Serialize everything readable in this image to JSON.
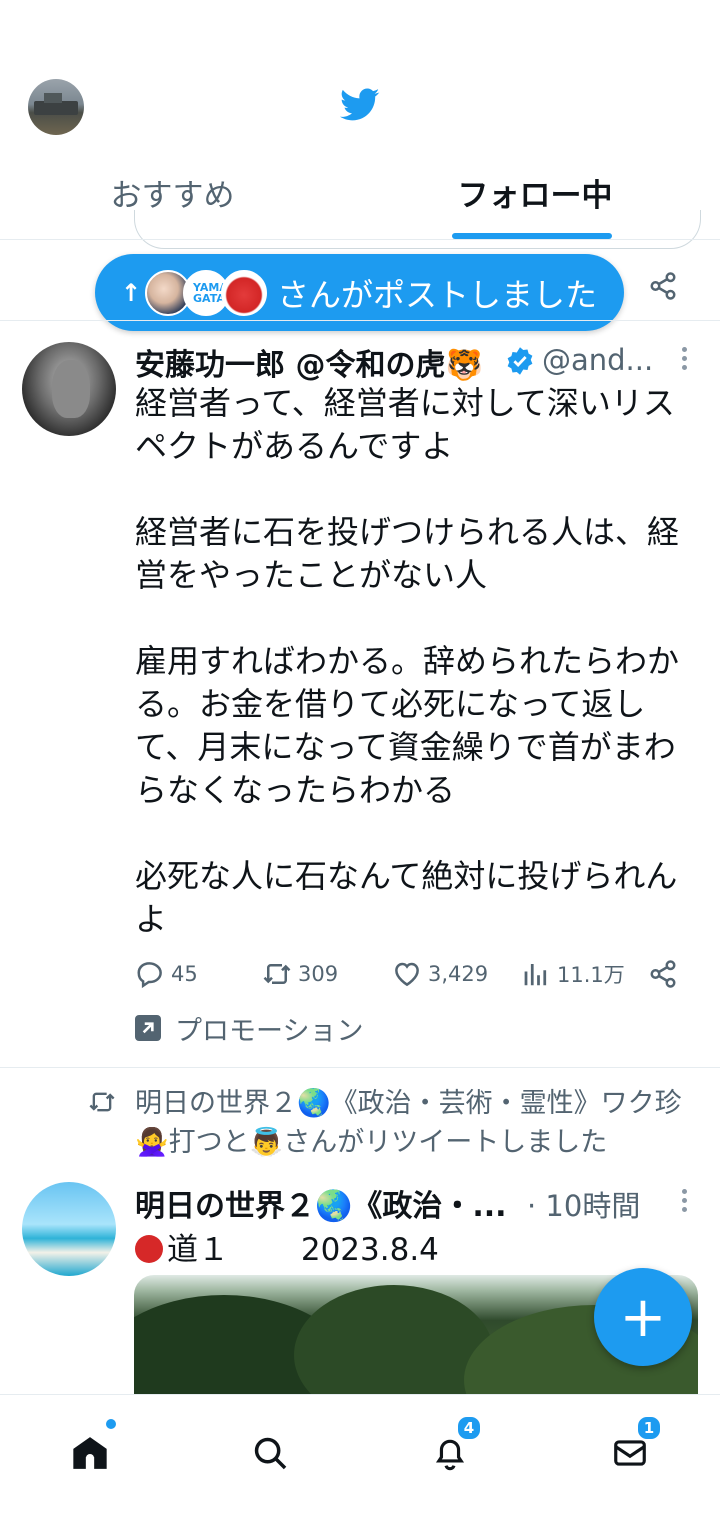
{
  "colors": {
    "accent": "#1d9bf0",
    "text": "#0f1419",
    "secondary": "#536471"
  },
  "header": {
    "tabs": [
      {
        "label": "おすすめ",
        "active": false
      },
      {
        "label": "フォロー中",
        "active": true
      }
    ]
  },
  "new_posts_pill": {
    "arrow": "↑",
    "label": "さんがポストしました"
  },
  "tweet1": {
    "name": "安藤功一郎 @令和の虎🐯",
    "handle": "@and...",
    "text": "経営者って、経営者に対して深いリスペクトがあるんですよ\n\n経営者に石を投げつけられる人は、経営をやったことがない人\n\n雇用すればわかる。辞められたらわかる。お金を借りて必死になって返して、月末になって資金繰りで首がまわらなくなったらわかる\n\n必死な人に石なんて絶対に投げられんよ",
    "replies": "45",
    "retweets": "309",
    "likes": "3,429",
    "views": "11.1万",
    "promo": "プロモーション"
  },
  "tweet2": {
    "context": "明日の世界２🌏《政治・芸術・霊性》ワク珍🙅‍♀️打つと👼さんがリツイートしました",
    "name": "明日の世界２🌏《政治・...",
    "time": "· 10時間",
    "text": "道１　　 2023.8.4"
  },
  "fab": {
    "label": "+"
  },
  "bottom_nav": {
    "items": [
      {
        "name": "home",
        "badge": ""
      },
      {
        "name": "search",
        "badge": ""
      },
      {
        "name": "notifications",
        "badge": "4"
      },
      {
        "name": "messages",
        "badge": "1"
      }
    ]
  },
  "icons": [
    "twitter-bird-icon",
    "share-icon",
    "verified-icon",
    "more-icon",
    "reply-icon",
    "retweet-icon",
    "like-icon",
    "views-icon",
    "promoted-icon",
    "home-icon",
    "search-icon",
    "bell-icon",
    "mail-icon"
  ]
}
